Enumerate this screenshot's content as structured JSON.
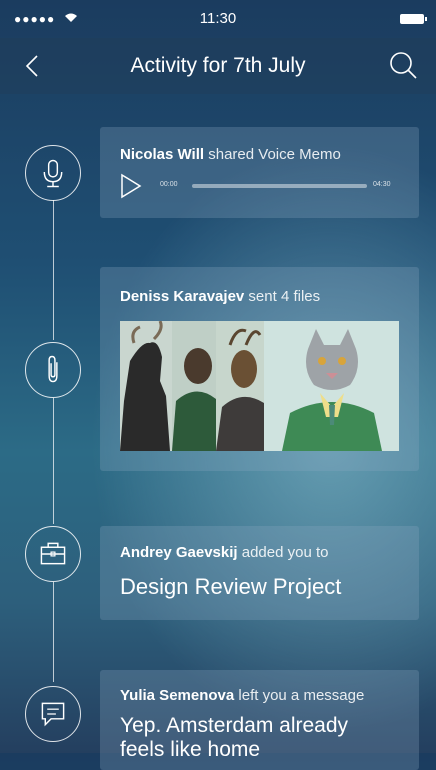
{
  "status_bar": {
    "signal_dots": "●●●●●",
    "wifi_icon": "wifi-icon",
    "time": "11:30",
    "battery_icon": "battery-icon"
  },
  "nav": {
    "back_icon": "chevron-left-icon",
    "title": "Activity for 7th July",
    "search_icon": "search-icon"
  },
  "activities": [
    {
      "type": "voice-memo",
      "icon": "microphone-icon",
      "user": "Nicolas Will",
      "action": "shared Voice Memo",
      "player": {
        "start_time": "00:00",
        "end_time": "04:30",
        "progress": 0.0
      }
    },
    {
      "type": "files",
      "icon": "paperclip-icon",
      "user": "Deniss Karavajev",
      "action": "sent 4 files",
      "file_count": 4
    },
    {
      "type": "project",
      "icon": "briefcase-icon",
      "user": "Andrey Gaevskij",
      "action": "added you to",
      "title": "Design Review Project"
    },
    {
      "type": "message",
      "icon": "chat-bubble-icon",
      "user": "Yulia Semenova",
      "action": "left you a message",
      "message": "Yep. Amsterdam already feels like home"
    }
  ],
  "colors": {
    "background_top": "#1b3c5f",
    "background_glow": "#96c8d7",
    "card": "#8caac3",
    "text": "#ffffff"
  }
}
